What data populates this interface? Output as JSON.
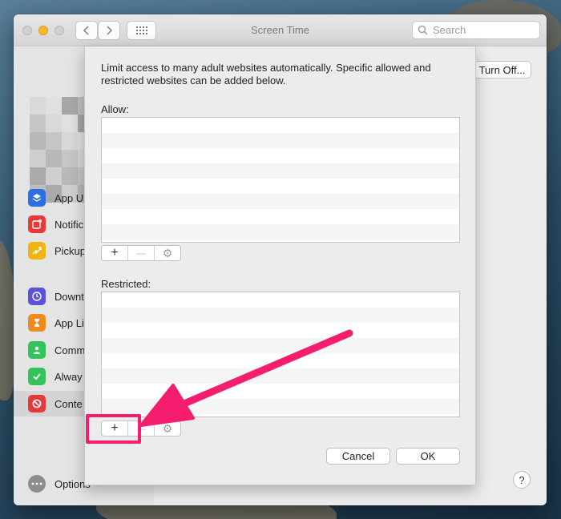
{
  "window": {
    "title": "Screen Time"
  },
  "toolbar": {
    "search_placeholder": "Search"
  },
  "sidebar": {
    "items": [
      {
        "label": "App U",
        "icon": "layers-icon",
        "color": "#2f6ee0"
      },
      {
        "label": "Notific",
        "icon": "notification-icon",
        "color": "#e8383a"
      },
      {
        "label": "Pickup",
        "icon": "pickup-icon",
        "color": "#f0b414"
      },
      {
        "label": "Downt",
        "icon": "downtime-icon",
        "color": "#5b52d6"
      },
      {
        "label": "App Li",
        "icon": "hourglass-icon",
        "color": "#ef8a1f"
      },
      {
        "label": "Comm",
        "icon": "contact-icon",
        "color": "#34c35a"
      },
      {
        "label": "Alway",
        "icon": "checkmark-icon",
        "color": "#34c35a"
      },
      {
        "label": "Conte",
        "icon": "restriction-icon",
        "color": "#e5393c"
      }
    ],
    "options_label": "Options"
  },
  "main": {
    "turn_off_label": "Turn Off..."
  },
  "sheet": {
    "description": "Limit access to many adult websites automatically. Specific allowed and restricted websites can be added below.",
    "allow_label": "Allow:",
    "restricted_label": "Restricted:",
    "add_symbol": "+",
    "remove_symbol": "—",
    "gear_symbol": "⚙",
    "cancel_label": "Cancel",
    "ok_label": "OK"
  },
  "help_label": "?",
  "annotation": {
    "color": "#f51e6e"
  }
}
